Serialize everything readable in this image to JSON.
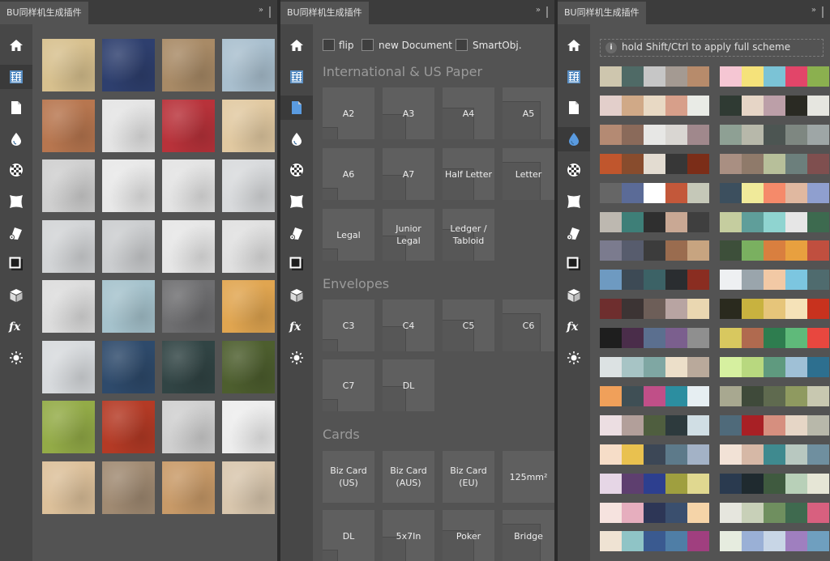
{
  "plugin_name": "BU同样机生成插件",
  "collapse_glyph": "»",
  "sidebar_icons": [
    "home-icon",
    "texture-grid-icon",
    "document-icon",
    "drop-icon",
    "checker-icon",
    "warp-icon",
    "roll-icon",
    "shadow-square-icon",
    "cube-icon",
    "fx-icon",
    "sun-icon"
  ],
  "panel1": {
    "active_icon": 1,
    "textures": [
      [
        "#d7c08e",
        "#2e3f6e",
        "#a88a66",
        "#a9bfce"
      ],
      [
        "#b7764f",
        "#e4e4e4",
        "#b8323a",
        "#e1c9a1"
      ],
      [
        "#cfcfcf",
        "#e8e8e8",
        "#e3e3e3",
        "#d8dadc"
      ],
      [
        "#d2d4d6",
        "#cbcdcf",
        "#e6e6e6",
        "#e0e0e0"
      ],
      [
        "#dcdcdc",
        "#a5c2cc",
        "#6e6e70",
        "#e0a550"
      ],
      [
        "#d7dadd",
        "#2e4a6b",
        "#314444",
        "#4d5e2e"
      ],
      [
        "#93ab47",
        "#b43a25",
        "#cfcfcf",
        "#ededed"
      ],
      [
        "#dcc09a",
        "#a08a72",
        "#c89a68",
        "#d8c6ad"
      ]
    ]
  },
  "panel2": {
    "active_icon": 2,
    "options": [
      {
        "label": "flip"
      },
      {
        "label": "new Document"
      },
      {
        "label": "SmartObj."
      }
    ],
    "sections": [
      {
        "title": "International & US Paper",
        "tiles": [
          "A2",
          "A3",
          "A4",
          "A5",
          "A6",
          "A7",
          "Half Letter",
          "Letter",
          "Legal",
          "Junior Legal",
          "Ledger / Tabloid"
        ]
      },
      {
        "title": "Envelopes",
        "tiles": [
          "C3",
          "C4",
          "C5",
          "C6",
          "C7",
          "DL"
        ]
      },
      {
        "title": "Cards",
        "tiles": [
          "Biz Card (US)",
          "Biz Card (AUS)",
          "Biz Card (EU)",
          "125mm²",
          "DL",
          "5x7In",
          "Poker",
          "Bridge"
        ]
      }
    ]
  },
  "panel3": {
    "active_icon": 3,
    "hint_icon": "info-icon",
    "hint": "hold Shift/Ctrl to apply full scheme",
    "schemes_left": [
      [
        "#cec6ae",
        "#4f6a66",
        "#c6c6c6",
        "#a49a92",
        "#b78b6b"
      ],
      [
        "#e3cfcb",
        "#d0a987",
        "#e8d9c4",
        "#d79f8a",
        "#e9ebe6"
      ],
      [
        "#b48a73",
        "#8a6a5a",
        "#e7e7e5",
        "#d9d6d2",
        "#a0888c"
      ],
      [
        "#c0562d",
        "#884c2d",
        "#e3dcd1",
        "#373737",
        "#7b2d18"
      ],
      [
        "#666666",
        "#5b6b97",
        "#ffffff",
        "#c3583a",
        "#c5c8b8"
      ],
      [
        "#bdb8b0",
        "#3e7f78",
        "#2f2f2f",
        "#c9a894",
        "#3f3f3f"
      ],
      [
        "#7b7b8e",
        "#575c6d",
        "#3c3c3c",
        "#9a6c4f",
        "#c7a480"
      ],
      [
        "#6e9ac1",
        "#3d4a55",
        "#3c6266",
        "#2a2d30",
        "#8a2d21"
      ],
      [
        "#6e2e2e",
        "#3c3434",
        "#6d5e58",
        "#b8a4a2",
        "#ead7b1"
      ],
      [
        "#1e1e1e",
        "#4a2d4a",
        "#5b6f8f",
        "#7b5f8e",
        "#8f8f8f"
      ],
      [
        "#dce2e3",
        "#a7c4c5",
        "#7fa7a3",
        "#ecdfc9",
        "#b9a99b"
      ],
      [
        "#f0a05a",
        "#3f4f55",
        "#c04f88",
        "#2c8ea0",
        "#e6eef2"
      ],
      [
        "#ecdee2",
        "#b29f9a",
        "#4f5e3f",
        "#2d3a3d",
        "#d0dee4"
      ],
      [
        "#f6ddc8",
        "#e9c14f",
        "#3c4756",
        "#5d7a8a",
        "#a3b2c6"
      ],
      [
        "#e6d6e6",
        "#5e3f6f",
        "#2d3f8f",
        "#9f9f3f",
        "#e0d890"
      ],
      [
        "#f6e3df",
        "#e6aebe",
        "#2d3656",
        "#3a4f6e",
        "#f5d4a8"
      ],
      [
        "#efe3d3",
        "#8fc4c6",
        "#3a5a90",
        "#4f7ea6",
        "#a03f7f"
      ]
    ],
    "schemes_right": [
      [
        "#f5c6d3",
        "#f5e27a",
        "#7bc3d6",
        "#e24569",
        "#8bb04f"
      ],
      [
        "#2f3a33",
        "#e6d5c6",
        "#bc9fa8",
        "#2a2a23",
        "#e6e6e0"
      ],
      [
        "#8ea094",
        "#b7b8aa",
        "#4c5552",
        "#7e8781",
        "#9ea6a6"
      ],
      [
        "#a98f82",
        "#8f7a6a",
        "#b7bf9a",
        "#6c7f7c",
        "#7f4f4f"
      ],
      [
        "#3c4f5e",
        "#f0ea9a",
        "#f58a6a",
        "#e0b8a0",
        "#8f9fcf"
      ],
      [
        "#c5cd9f",
        "#5f9e9a",
        "#8fd4d0",
        "#e6e6e6",
        "#3d6a4f"
      ],
      [
        "#3d4f3a",
        "#7ab060",
        "#d97f3f",
        "#e8a03f",
        "#c04f3f"
      ],
      [
        "#eef0f2",
        "#9aa5ac",
        "#f2c9a5",
        "#7cc6e0",
        "#4f6b6e"
      ],
      [
        "#2a2a1e",
        "#c8b23f",
        "#e6c57a",
        "#f5e2b8",
        "#c8321e"
      ],
      [
        "#d8c85f",
        "#b06a4f",
        "#2e7d4f",
        "#5fba7a",
        "#e8473f"
      ],
      [
        "#d6f0a0",
        "#b8d87f",
        "#5f9a7f",
        "#9fc0d6",
        "#2d6f8f"
      ],
      [
        "#a8a890",
        "#3f4a3a",
        "#5f6a4f",
        "#8f9a60",
        "#c8c8b0"
      ],
      [
        "#4f6a7a",
        "#a82025",
        "#d68f7f",
        "#e6d6c6",
        "#b8b8aa"
      ],
      [
        "#f2e2d6",
        "#d6b8a6",
        "#3f8a8f",
        "#b8c8c0",
        "#6f8f9f"
      ],
      [
        "#2a3a4f",
        "#1f2a2f",
        "#3f5a3f",
        "#b8d0b8",
        "#e6e6d6"
      ],
      [
        "#e6e6de",
        "#c8d0b8",
        "#6f8f5f",
        "#3f6a4f",
        "#d8607f"
      ],
      [
        "#e6ecdf",
        "#9ab0d6",
        "#c8d6e6",
        "#9f7fbf",
        "#6f9fbf"
      ]
    ]
  }
}
